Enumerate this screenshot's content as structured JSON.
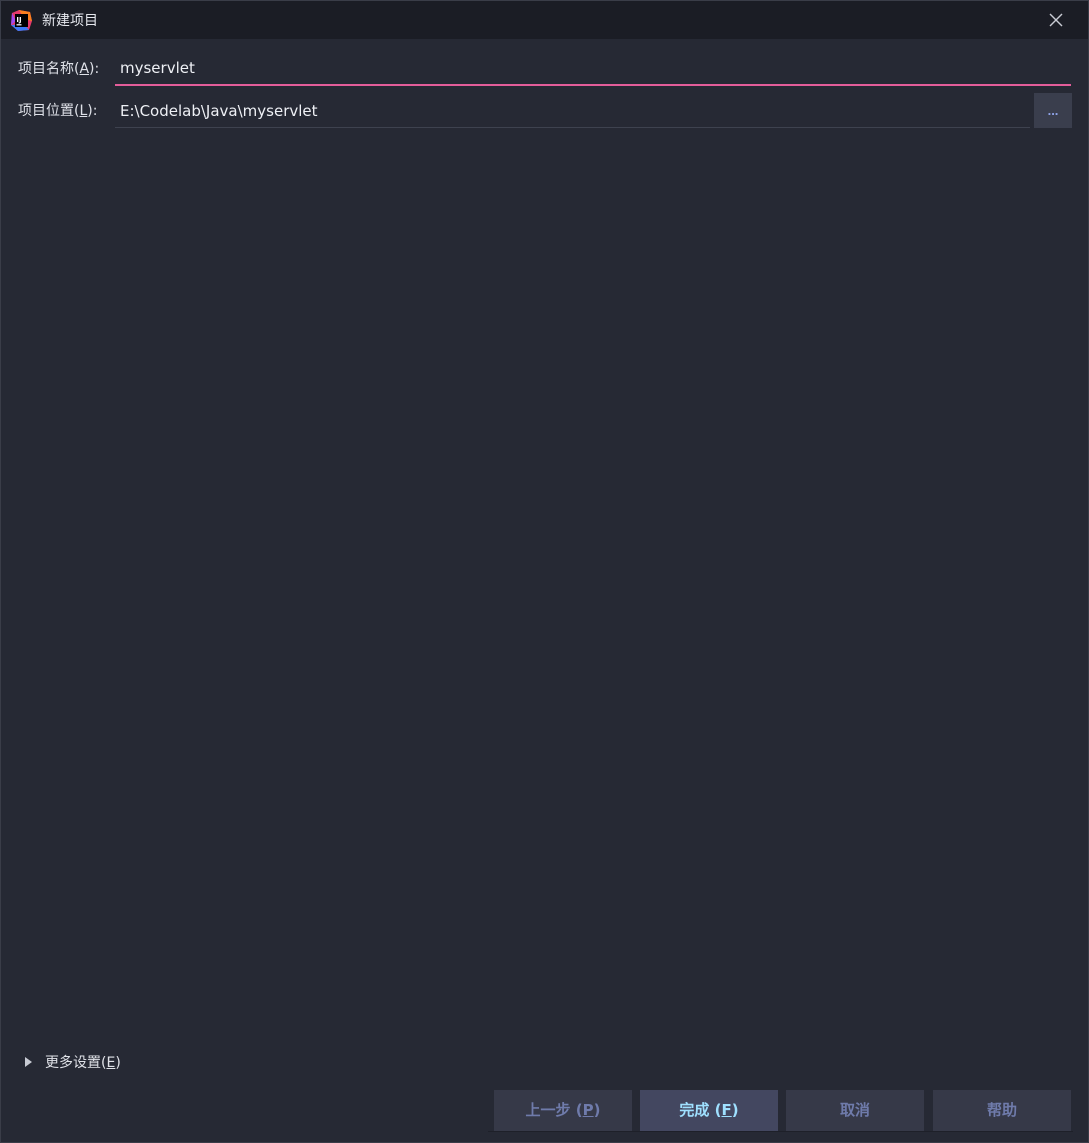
{
  "window": {
    "title": "新建项目"
  },
  "form": {
    "name_label": "项目名称(",
    "name_mnemonic": "A",
    "name_suffix": "):",
    "name_value": "myservlet",
    "location_label": "项目位置(",
    "location_mnemonic": "L",
    "location_suffix": "):",
    "location_value": "E:\\Codelab\\Java\\myservlet",
    "browse_label": "..."
  },
  "more_settings": {
    "label": "更多设置(",
    "mnemonic": "E",
    "suffix": ")",
    "expanded": false
  },
  "footer": {
    "previous_label": "上一步 (",
    "previous_mnemonic": "P",
    "previous_suffix": ")",
    "finish_label": "完成 (",
    "finish_mnemonic": "F",
    "finish_suffix": ")",
    "cancel_label": "取消",
    "help_label": "帮助"
  },
  "colors": {
    "background": "#262934",
    "titlebar": "#1b1d25",
    "focus_underline": "#e35d9a",
    "primary_button_text": "#9fe0ff",
    "secondary_button_text": "#6f7bab"
  }
}
